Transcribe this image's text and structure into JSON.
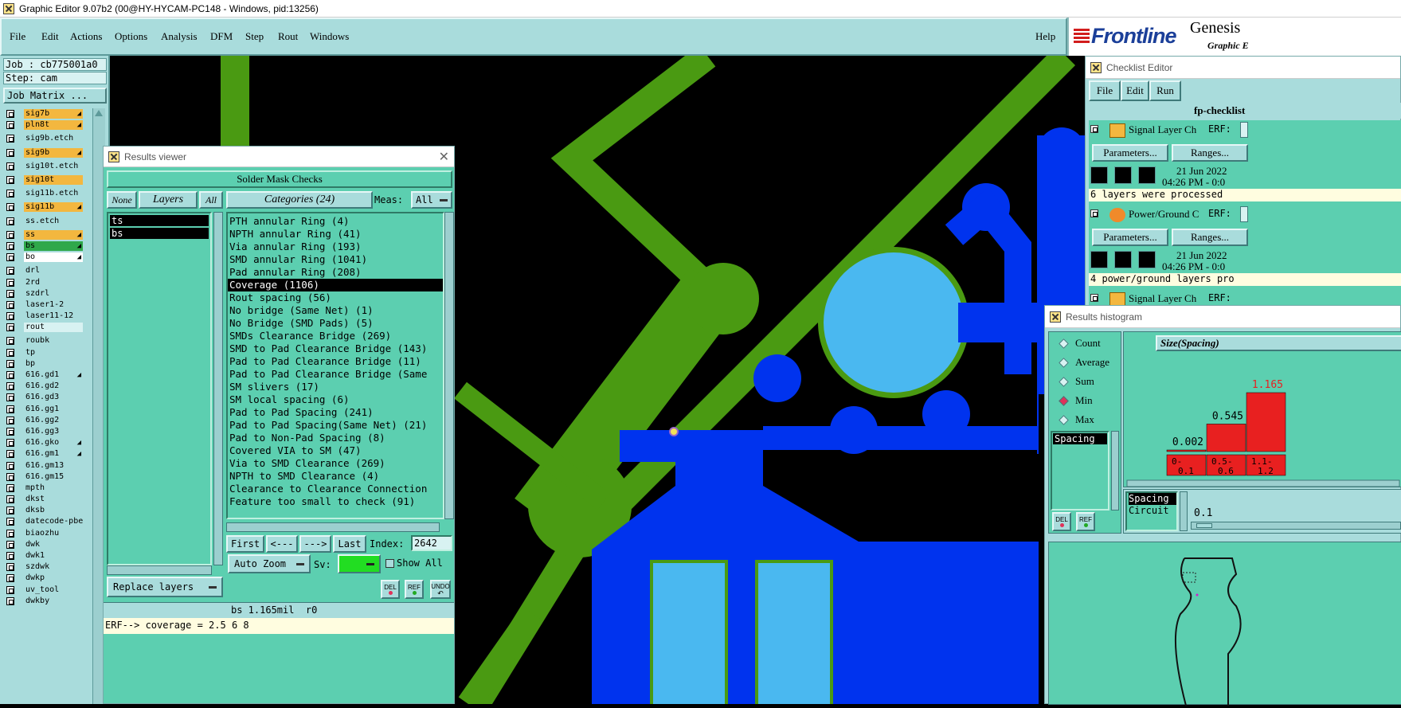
{
  "os_window": {
    "title": "Graphic Editor 9.07b2 (00@HY-HYCAM-PC148 - Windows, pid:13256)"
  },
  "menubar": {
    "items": [
      "File",
      "Edit",
      "Actions",
      "Options",
      "Analysis",
      "DFM",
      "Step",
      "Rout",
      "Windows"
    ],
    "help": "Help"
  },
  "brand": {
    "logo": "Frontline",
    "product": "Genesis",
    "subtitle": "Graphic E"
  },
  "job": {
    "job_label": "Job : cb775001a0",
    "step_label": "Step: cam",
    "job_matrix_button": "Job Matrix ..."
  },
  "layers": [
    {
      "name": "sig7b",
      "color": "#f3b73f",
      "mark": "◢",
      "gap": false
    },
    {
      "name": "pln8t",
      "color": "#f3b73f",
      "mark": "◢",
      "gap": false
    },
    {
      "name": "sig9b.etch",
      "color": "#a9dcdc",
      "mark": "",
      "gap": true
    },
    {
      "name": "sig9b",
      "color": "#f3b73f",
      "mark": "◢",
      "gap": true
    },
    {
      "name": "sig10t.etch",
      "color": "#a9dcdc",
      "mark": "",
      "gap": true
    },
    {
      "name": "sig10t",
      "color": "#f3b73f",
      "mark": "",
      "gap": true
    },
    {
      "name": "sig11b.etch",
      "color": "#a9dcdc",
      "mark": "",
      "gap": true
    },
    {
      "name": "sig11b",
      "color": "#f3b73f",
      "mark": "◢",
      "gap": true
    },
    {
      "name": "ss.etch",
      "color": "#a9dcdc",
      "mark": "",
      "gap": true
    },
    {
      "name": "ss",
      "color": "#f3b73f",
      "mark": "◢",
      "gap": true
    },
    {
      "name": "bs",
      "color": "#2fa84a",
      "mark": "◢",
      "gap": false
    },
    {
      "name": "bo",
      "color": "#ffffff",
      "mark": "◢",
      "gap": false
    },
    {
      "name": "drl",
      "color": "#a9dcdc",
      "mark": "",
      "gap": true
    },
    {
      "name": "2rd",
      "color": "#a9dcdc",
      "mark": "",
      "gap": false
    },
    {
      "name": "szdrl",
      "color": "#a9dcdc",
      "mark": "",
      "gap": false
    },
    {
      "name": "laser1-2",
      "color": "#a9dcdc",
      "mark": "",
      "gap": false
    },
    {
      "name": "laser11-12",
      "color": "#a9dcdc",
      "mark": "",
      "gap": false
    },
    {
      "name": "rout",
      "color": "#d8f2f2",
      "mark": "",
      "gap": false
    },
    {
      "name": "roubk",
      "color": "#a9dcdc",
      "mark": "",
      "gap": true
    },
    {
      "name": "tp",
      "color": "#a9dcdc",
      "mark": "",
      "gap": false
    },
    {
      "name": "bp",
      "color": "#a9dcdc",
      "mark": "",
      "gap": false
    },
    {
      "name": "616.gd1",
      "color": "#a9dcdc",
      "mark": "◢",
      "gap": false
    },
    {
      "name": "616.gd2",
      "color": "#a9dcdc",
      "mark": "",
      "gap": false
    },
    {
      "name": "616.gd3",
      "color": "#a9dcdc",
      "mark": "",
      "gap": false
    },
    {
      "name": "616.gg1",
      "color": "#a9dcdc",
      "mark": "",
      "gap": false
    },
    {
      "name": "616.gg2",
      "color": "#a9dcdc",
      "mark": "",
      "gap": false
    },
    {
      "name": "616.gg3",
      "color": "#a9dcdc",
      "mark": "",
      "gap": false
    },
    {
      "name": "616.gko",
      "color": "#a9dcdc",
      "mark": "◢",
      "gap": false
    },
    {
      "name": "616.gm1",
      "color": "#a9dcdc",
      "mark": "◢",
      "gap": false
    },
    {
      "name": "616.gm13",
      "color": "#a9dcdc",
      "mark": "",
      "gap": false
    },
    {
      "name": "616.gm15",
      "color": "#a9dcdc",
      "mark": "",
      "gap": false
    },
    {
      "name": "mpth",
      "color": "#a9dcdc",
      "mark": "",
      "gap": false
    },
    {
      "name": "dkst",
      "color": "#a9dcdc",
      "mark": "",
      "gap": false
    },
    {
      "name": "dksb",
      "color": "#a9dcdc",
      "mark": "",
      "gap": false
    },
    {
      "name": "datecode-pbe",
      "color": "#a9dcdc",
      "mark": "",
      "gap": false
    },
    {
      "name": "biaozhu",
      "color": "#a9dcdc",
      "mark": "",
      "gap": false
    },
    {
      "name": "dwk",
      "color": "#a9dcdc",
      "mark": "",
      "gap": false
    },
    {
      "name": "dwk1",
      "color": "#a9dcdc",
      "mark": "",
      "gap": false
    },
    {
      "name": "szdwk",
      "color": "#a9dcdc",
      "mark": "",
      "gap": false
    },
    {
      "name": "dwkp",
      "color": "#a9dcdc",
      "mark": "",
      "gap": false
    },
    {
      "name": "uv_tool",
      "color": "#a9dcdc",
      "mark": "",
      "gap": false
    },
    {
      "name": "dwkby",
      "color": "#a9dcdc",
      "mark": "",
      "gap": false
    }
  ],
  "results_viewer": {
    "title": "Results viewer",
    "header": "Solder Mask Checks",
    "none_btn": "None",
    "layers_btn": "Layers",
    "all_btn": "All",
    "layer_items": [
      "ts",
      "bs"
    ],
    "categories_btn": "Categories (24)",
    "meas_label": "Meas:",
    "meas_value": "All",
    "categories": [
      "PTH annular Ring (4)",
      "NPTH annular Ring (41)",
      "Via annular Ring (193)",
      "SMD annular Ring (1041)",
      "Pad annular Ring (208)",
      "Coverage (1106)",
      "Rout spacing (56)",
      "No bridge (Same Net) (1)",
      "No Bridge (SMD Pads) (5)",
      "SMDs Clearance Bridge (269)",
      "SMD to Pad Clearance Bridge (143)",
      "Pad to Pad Clearance Bridge (11)",
      "Pad to Pad Clearance Bridge (Same",
      "SM slivers (17)",
      "SM local spacing (6)",
      "Pad to Pad Spacing (241)",
      "Pad to Pad Spacing(Same Net) (21)",
      "Pad to Non-Pad Spacing (8)",
      "Covered VIA to SM (47)",
      "Via to SMD Clearance (269)",
      "NPTH to SMD Clearance (4)",
      "Clearance to Clearance Connection",
      "Feature too small to check (91)"
    ],
    "selected_category_index": 5,
    "first_btn": "First",
    "prev_btn": "<---",
    "next_btn": "--->",
    "last_btn": "Last",
    "index_label": "Index:",
    "index_value": "2642",
    "replace_layers": "Replace layers",
    "auto_zoom": "Auto Zoom",
    "sv_label": "Sv:",
    "show_all": "Show All",
    "del": "DEL",
    "ref": "REF",
    "undo": "UNDO",
    "status": "bs 1.165mil  r0",
    "erf_line": "ERF--> coverage = 2.5 6 8"
  },
  "checklist_editor": {
    "title": "Checklist Editor",
    "menu": [
      "File",
      "Edit",
      "Run"
    ],
    "checklist_name": "fp-checklist",
    "items": [
      {
        "name": "Signal Layer Ch",
        "erf": "ERF:",
        "params": "Parameters...",
        "ranges": "Ranges...",
        "date": "21 Jun 2022",
        "time": "04:26 PM - 0:0",
        "message": "6 layers were processed"
      },
      {
        "name": "Power/Ground C",
        "erf": "ERF:",
        "params": "Parameters...",
        "ranges": "Ranges...",
        "date": "21 Jun 2022",
        "time": "04:26 PM - 0:0",
        "message": "4 power/ground layers pro"
      },
      {
        "name": "Signal Layer Ch",
        "erf": "ERF:"
      }
    ]
  },
  "results_histogram": {
    "title": "Results histogram",
    "radios": [
      "Count",
      "Average",
      "Sum",
      "Min",
      "Max"
    ],
    "selected_radio": "Min",
    "list_item": "Spacing",
    "chart_title": "Size(Spacing)",
    "del": "DEL",
    "ref": "REF",
    "bottom_items": [
      "Spacing",
      "Circuit"
    ],
    "bottom_value": "0.1",
    "chart_data": {
      "type": "bar",
      "categories": [
        "0-0.1",
        "0.5-0.6",
        "1.1-1.2"
      ],
      "values": [
        0.002,
        0.545,
        1.165
      ],
      "data_labels": [
        "0.002",
        "0.545",
        "1.165"
      ],
      "bar_color": "#e82020",
      "highlight_label_color": "#e82020"
    }
  }
}
